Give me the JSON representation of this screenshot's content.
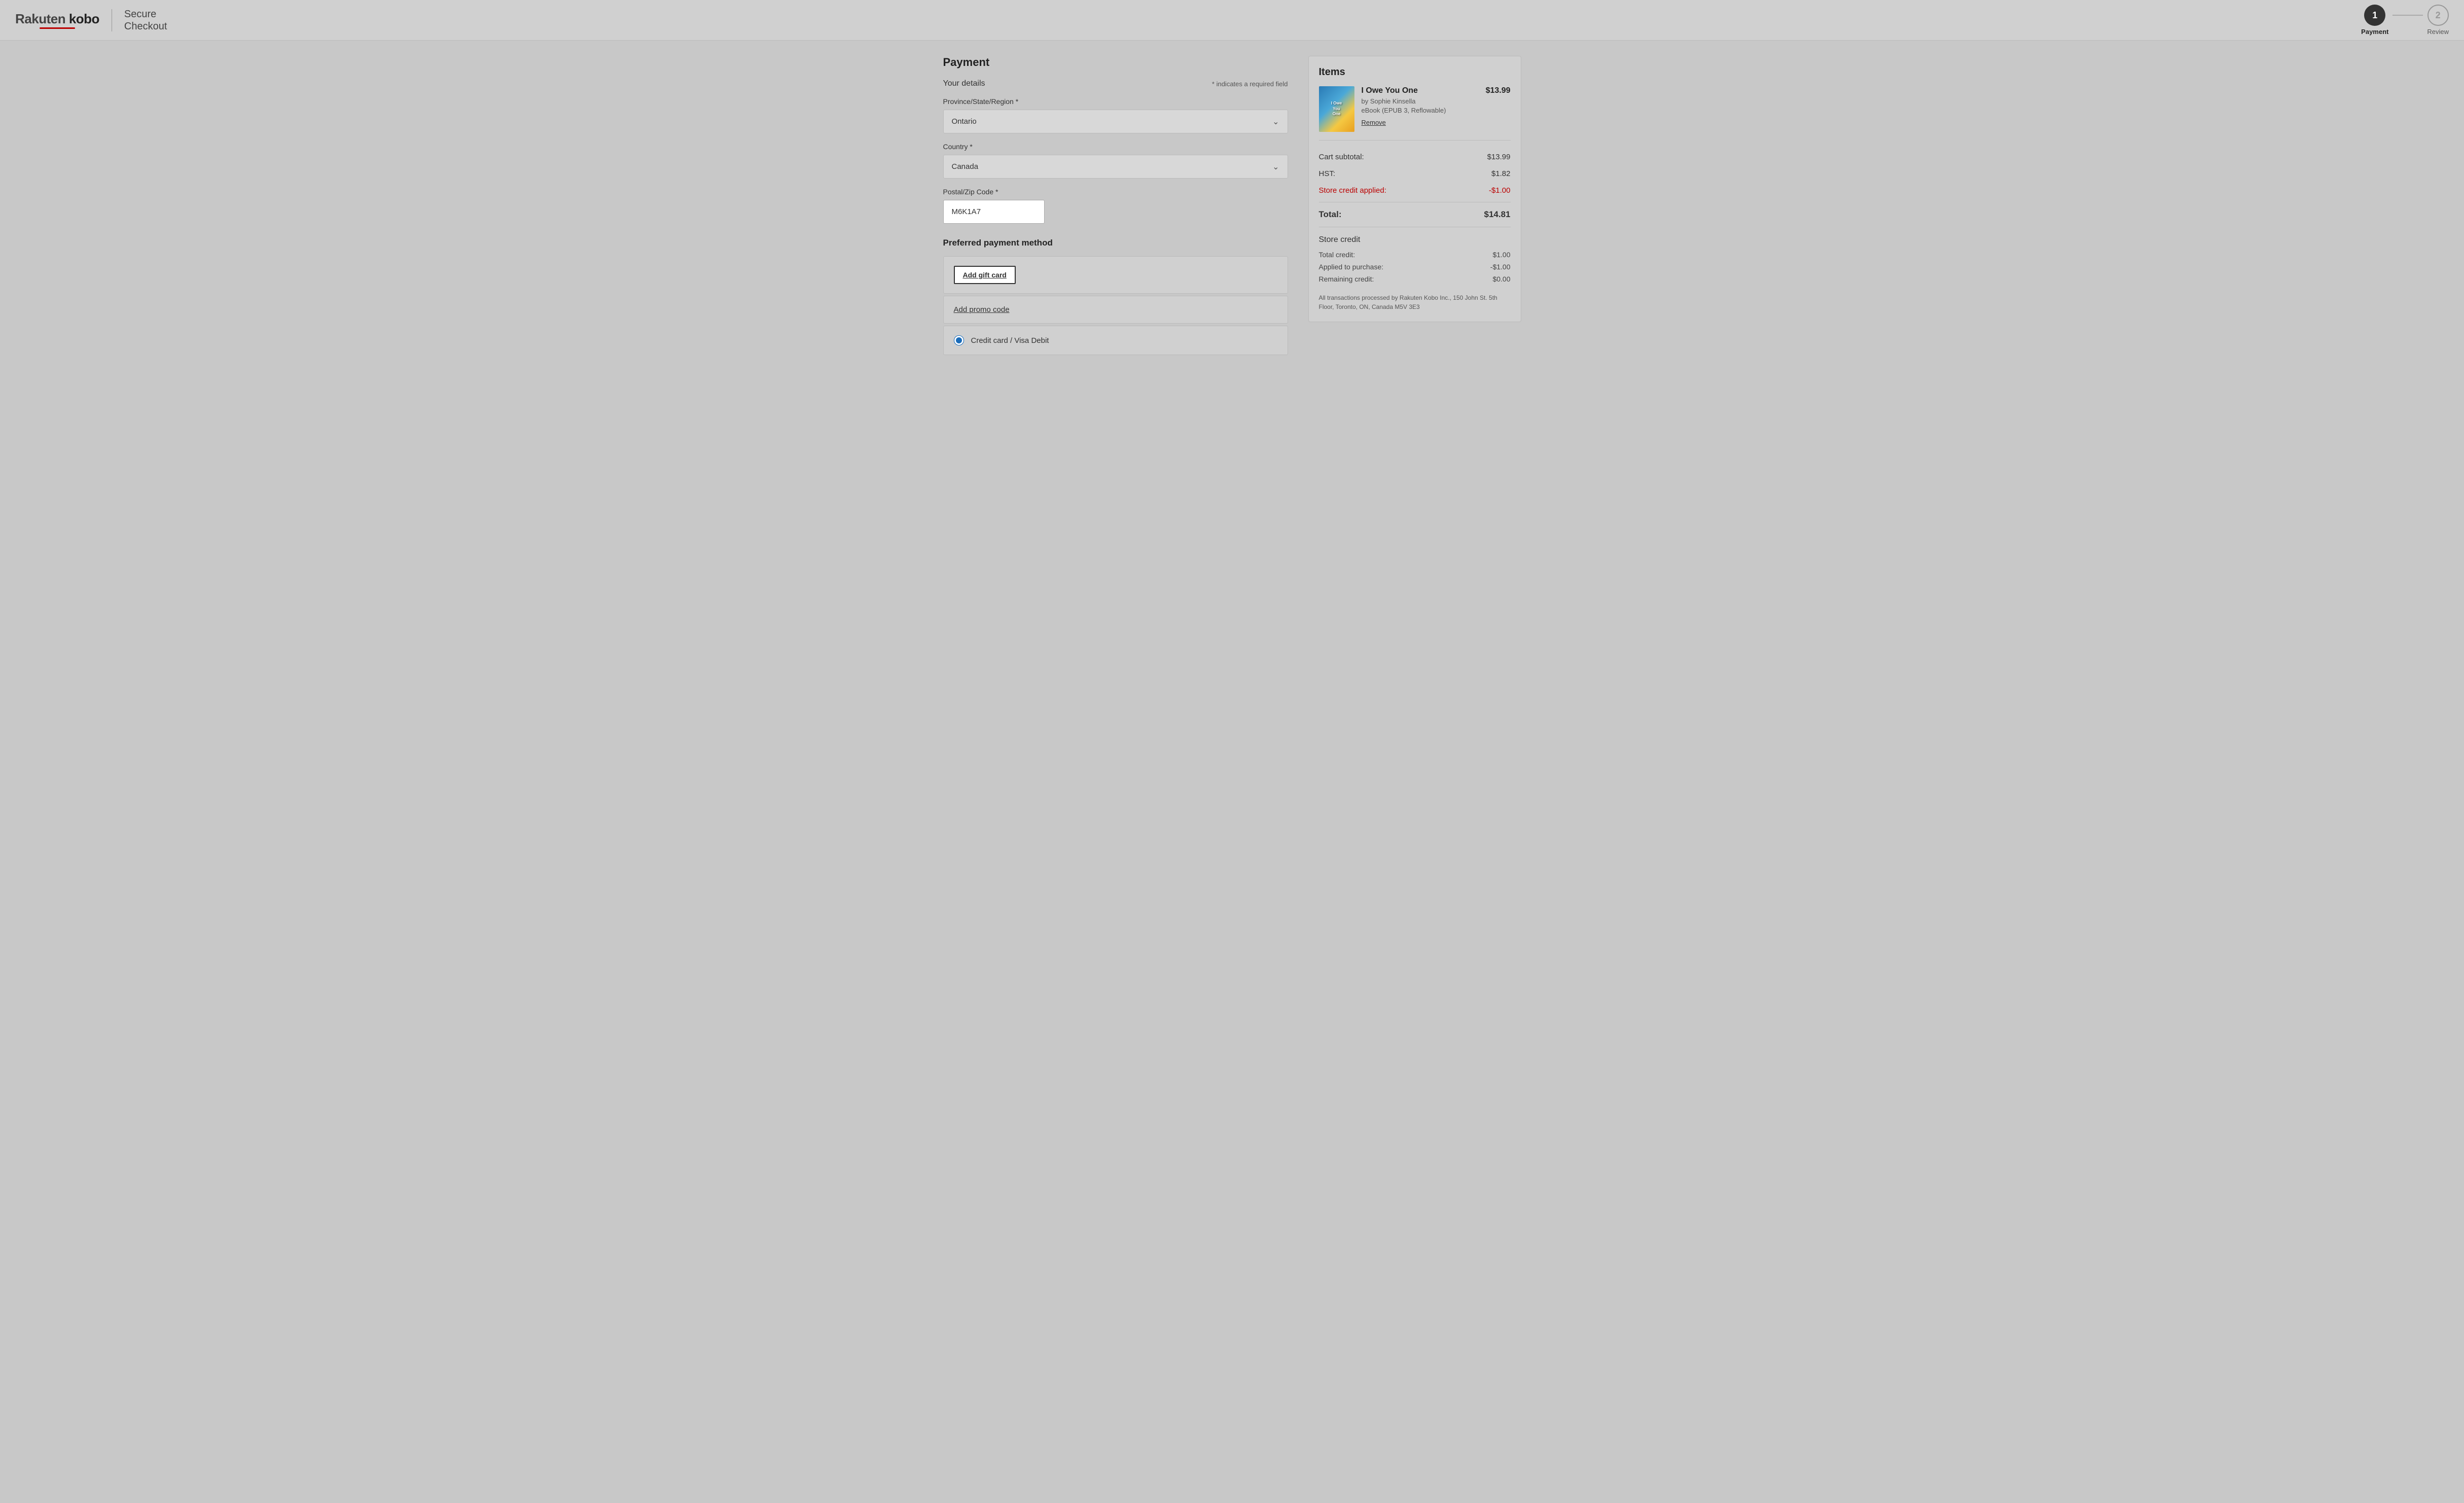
{
  "header": {
    "logo_rakuten": "Rakuten",
    "logo_kobo": "kobo",
    "checkout_title_line1": "Secure",
    "checkout_title_line2": "Checkout",
    "steps": [
      {
        "number": "1",
        "label": "Payment",
        "active": true
      },
      {
        "number": "2",
        "label": "Review",
        "active": false
      }
    ]
  },
  "payment": {
    "section_title": "Payment",
    "your_details_label": "Your details",
    "required_field_note": "* indicates a required field",
    "province_label": "Province/State/Region *",
    "province_value": "Ontario",
    "country_label": "Country *",
    "country_value": "Canada",
    "postal_label": "Postal/Zip Code *",
    "postal_value": "M6K1A7",
    "payment_method_title": "Preferred payment method",
    "add_gift_card_label": "Add gift card",
    "add_promo_label": "Add promo code",
    "credit_card_label": "Credit card / Visa Debit"
  },
  "items": {
    "section_title": "Items",
    "book": {
      "title": "I Owe You One",
      "author": "by Sophie Kinsella",
      "format": "eBook (EPUB 3, Reflowable)",
      "price": "$13.99",
      "remove_label": "Remove",
      "cover_text": "I Owe\nYou\nOne"
    },
    "cart_subtotal_label": "Cart subtotal:",
    "cart_subtotal_value": "$13.99",
    "hst_label": "HST:",
    "hst_value": "$1.82",
    "store_credit_applied_label": "Store credit applied:",
    "store_credit_applied_value": "-$1.00",
    "total_label": "Total:",
    "total_value": "$14.81",
    "store_credit_title": "Store credit",
    "total_credit_label": "Total credit:",
    "total_credit_value": "$1.00",
    "applied_to_purchase_label": "Applied to purchase:",
    "applied_to_purchase_value": "-$1.00",
    "remaining_credit_label": "Remaining credit:",
    "remaining_credit_value": "$0.00",
    "transactions_note": "All transactions processed by Rakuten Kobo Inc., 150 John St. 5th Floor, Toronto, ON, Canada M5V 3E3"
  }
}
